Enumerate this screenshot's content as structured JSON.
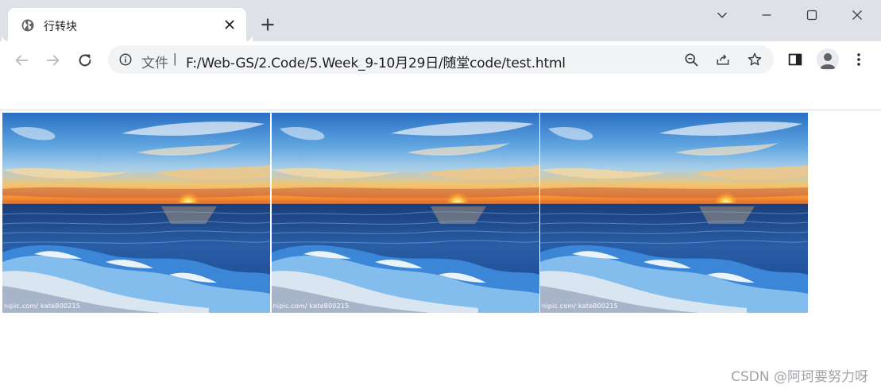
{
  "tab": {
    "title": "行转块",
    "favicon": "globe-icon"
  },
  "toolbar": {
    "scheme_label": "文件",
    "scheme_separator": "|",
    "url": "F:/Web-GS/2.Code/5.Week_9-10月29日/随堂code/test.html"
  },
  "images": [
    {
      "watermark": "nipic.com/ kate800215",
      "alt": "sunset-over-ocean"
    },
    {
      "watermark": "nipic.com/ kate800215",
      "alt": "sunset-over-ocean"
    },
    {
      "watermark": "nipic.com/ kate800215",
      "alt": "sunset-over-ocean"
    }
  ],
  "footer": {
    "watermark": "CSDN @阿珂要努力呀"
  },
  "colors": {
    "titlebar_bg": "#dee1e6",
    "omnibox_bg": "#f1f3f4",
    "icon_gray": "#5f6368"
  }
}
